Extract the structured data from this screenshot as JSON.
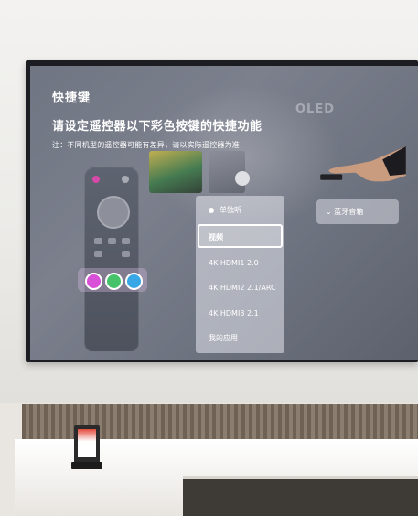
{
  "tv_ui": {
    "title": "快捷键",
    "subtitle": "请设定遥控器以下彩色按键的快捷功能",
    "note": "注：不同机型的遥控器可能有差异，请以实际遥控器为准",
    "menu": {
      "items": [
        {
          "label": "单独听",
          "radio": true
        },
        {
          "label": "视频",
          "selected": true
        },
        {
          "label": "4K HDMI1 2.0"
        },
        {
          "label": "4K HDMI2 2.1/ARC"
        },
        {
          "label": "4K HDMI3 2.1"
        },
        {
          "label": "我的应用"
        }
      ]
    },
    "bluetooth_button": {
      "label": "蓝牙音箱",
      "icon": "chevron-down-icon"
    },
    "remote": {
      "color_keys": [
        "#d84fd8",
        "#46c36a",
        "#39a6e6"
      ]
    }
  },
  "colors": {
    "screen": "#757a87",
    "menu_text": "#ffffff",
    "bezel": "#1b1d22"
  }
}
